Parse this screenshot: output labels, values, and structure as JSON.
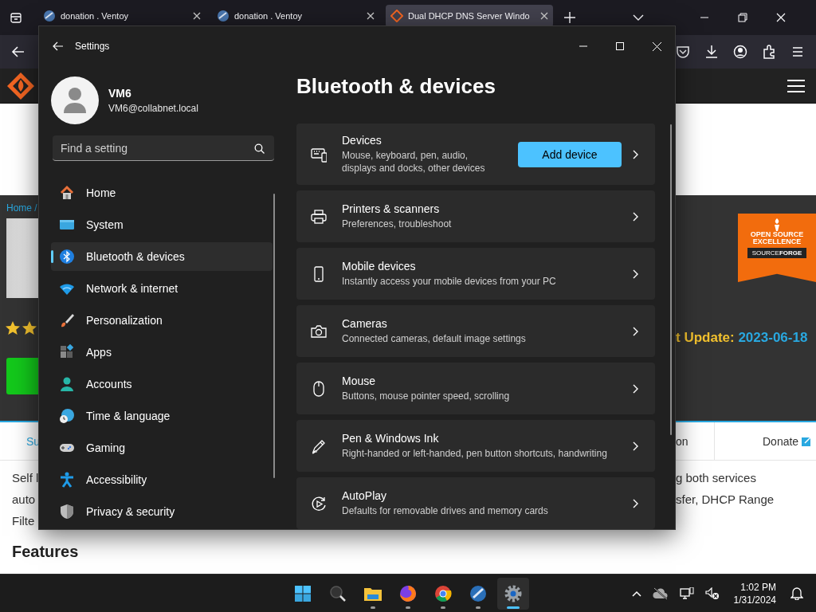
{
  "browser": {
    "tabs": [
      {
        "title": "donation . Ventoy",
        "selected": false
      },
      {
        "title": "donation . Ventoy",
        "selected": false
      },
      {
        "title": "Dual DHCP DNS Server Windo",
        "selected": true
      }
    ],
    "page": {
      "breadcrumb": "Home /",
      "update_label": "t Update:",
      "update_date": "2023-06-18",
      "badge_title": "OPEN SOURCE EXCELLENCE",
      "badge_brand": "SOURCE**FORGE**",
      "tab_left": "Su",
      "tab_mid": "on",
      "tab_donate": "Donate",
      "text_left": [
        "Self l",
        "auto",
        "Filte"
      ],
      "text_right": [
        "g both services",
        "sfer, DHCP Range"
      ],
      "heading": "Features"
    }
  },
  "settings": {
    "title": "Settings",
    "user": {
      "name": "VM6",
      "email": "VM6@collabnet.local"
    },
    "search": {
      "placeholder": "Find a setting"
    },
    "nav": [
      {
        "label": "Home",
        "selected": false
      },
      {
        "label": "System",
        "selected": false
      },
      {
        "label": "Bluetooth & devices",
        "selected": true
      },
      {
        "label": "Network & internet",
        "selected": false
      },
      {
        "label": "Personalization",
        "selected": false
      },
      {
        "label": "Apps",
        "selected": false
      },
      {
        "label": "Accounts",
        "selected": false
      },
      {
        "label": "Time & language",
        "selected": false
      },
      {
        "label": "Gaming",
        "selected": false
      },
      {
        "label": "Accessibility",
        "selected": false
      },
      {
        "label": "Privacy & security",
        "selected": false
      }
    ],
    "heading": "Bluetooth & devices",
    "cards": [
      {
        "title": "Devices",
        "description": "Mouse, keyboard, pen, audio, displays and docks, other devices",
        "button": "Add device"
      },
      {
        "title": "Printers & scanners",
        "description": "Preferences, troubleshoot"
      },
      {
        "title": "Mobile devices",
        "description": "Instantly access your mobile devices from your PC"
      },
      {
        "title": "Cameras",
        "description": "Connected cameras, default image settings"
      },
      {
        "title": "Mouse",
        "description": "Buttons, mouse pointer speed, scrolling"
      },
      {
        "title": "Pen & Windows Ink",
        "description": "Right-handed or left-handed, pen button shortcuts, handwriting"
      },
      {
        "title": "AutoPlay",
        "description": "Defaults for removable drives and memory cards"
      }
    ]
  },
  "taskbar": {
    "apps": [
      {
        "running": false,
        "selected": false
      },
      {
        "running": false,
        "selected": false
      },
      {
        "running": true,
        "selected": false
      },
      {
        "running": true,
        "selected": false
      },
      {
        "running": true,
        "selected": false
      },
      {
        "running": true,
        "selected": false
      },
      {
        "running": true,
        "selected": true
      }
    ],
    "time": "1:02 PM",
    "date": "1/31/2024"
  }
}
